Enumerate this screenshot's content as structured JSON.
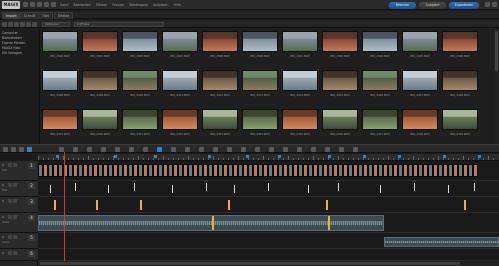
{
  "app": {
    "logo": "MAGIX"
  },
  "menu": [
    "Datei",
    "Bearbeiten",
    "Effekte",
    "Fenster",
    "Wiedergabe",
    "Aufgaben",
    "Hilfe"
  ],
  "top_buttons": {
    "burn": "Brennen",
    "export": "Ausgabe",
    "share": "Exportieren"
  },
  "tabs": [
    "Import",
    "Schnitt",
    "Titel",
    "Effekte"
  ],
  "pathbar": {
    "view": "Optionen",
    "path": "C:\\Fotos"
  },
  "sidebar": [
    "Computer",
    "Bibliotheken",
    "Eigene Medien",
    "MAGIX Foto",
    "Mit Vorlagen"
  ],
  "thumb_labels": [
    [
      "IMG_2890.MOV",
      "IMG_2891.MOV",
      "IMG_2893.MOV",
      "IMG_2897.MOV",
      "IMG_2898.MOV",
      "IMG_2899.MOV",
      "IMG_2901.MOV",
      "IMG_2902.MOV",
      "IMG_2904.MOV",
      "IMG_2905.MOV",
      "IMG_2906.MOV"
    ],
    [
      "IMG_2908.MOV",
      "IMG_2909.MOV",
      "IMG_2910.MOV",
      "IMG_2911.MOV",
      "IMG_2912.MOV",
      "IMG_2913.MOV",
      "IMG_2914.MOV",
      "IMG_2915.MOV",
      "IMG_2916.MOV",
      "IMG_2917.MOV",
      "IMG_2918.MOV"
    ],
    [
      "IMG_2919.MOV",
      "IMG_2920.MOV",
      "IMG_2921.MOV",
      "IMG_2922.MOV",
      "IMG_2923.MOV",
      "IMG_2924.MOV",
      "IMG_2925.MOV",
      "IMG_2926.MOV",
      "IMG_2927.MOV",
      "IMG_2928.MOV",
      "IMG_2929.MOV"
    ]
  ],
  "tracks": [
    {
      "num": "1",
      "name": "Film"
    },
    {
      "num": "2",
      "name": "Film"
    },
    {
      "num": "3",
      "name": ""
    },
    {
      "num": "4",
      "name": "Audio"
    },
    {
      "num": "5",
      "name": "Audio"
    },
    {
      "num": "6",
      "name": ""
    }
  ],
  "colors": {
    "accent": "#3d7fc4",
    "playhead": "#d23a2a",
    "marker": "#e8b33a"
  }
}
